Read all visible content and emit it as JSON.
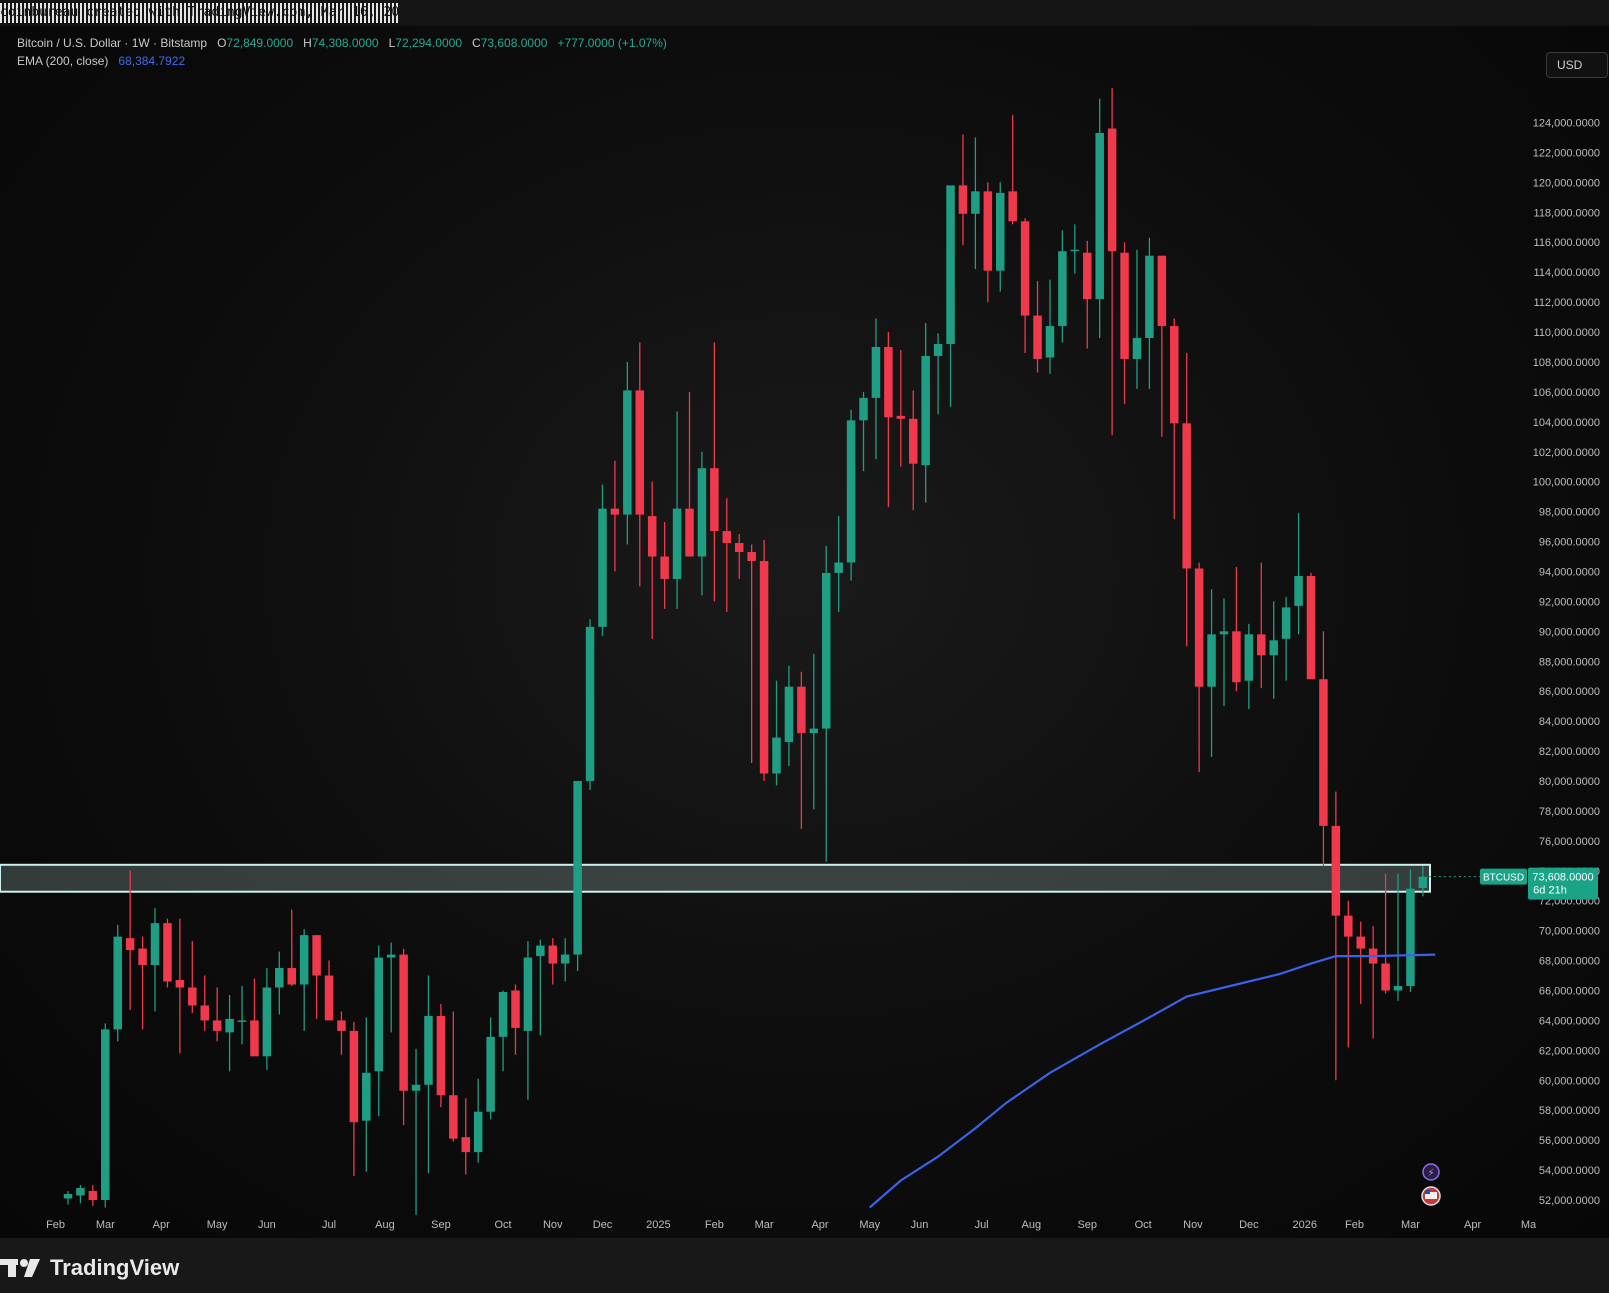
{
  "credit": "coinbureau created with TradingView.com, Mar 16, 2026 07:48 UTC+4",
  "legend": {
    "symbol": "Bitcoin / U.S. Dollar · 1W · Bitstamp",
    "o_label": "O",
    "o_value": "72,849.0000",
    "h_label": "H",
    "h_value": "74,308.0000",
    "l_label": "L",
    "l_value": "72,294.0000",
    "c_label": "C",
    "c_value": "73,608.0000",
    "change": "+777.0000 (+1.07%)",
    "ema_label": "EMA (200, close)",
    "ema_value": "68,384.7922"
  },
  "currency": "USD",
  "price_tag": {
    "symbol": "BTCUSD",
    "price": "73,608.0000",
    "countdown": "6d 21h"
  },
  "brand": "TradingView",
  "colors": {
    "up": "#1f9e84",
    "down": "#f0394c",
    "ema": "#3a62e8",
    "zone": "#c9f2f0",
    "tag": "#1aa386"
  },
  "chart_data": {
    "type": "candlestick",
    "interval": "1W",
    "ylim": [
      51000,
      128000
    ],
    "y_ticks": [
      "52,000.0000",
      "54,000.0000",
      "56,000.0000",
      "58,000.0000",
      "60,000.0000",
      "62,000.0000",
      "64,000.0000",
      "66,000.0000",
      "68,000.0000",
      "70,000.0000",
      "72,000.0000",
      "74,000.0000",
      "76,000.0000",
      "78,000.0000",
      "80,000.0000",
      "82,000.0000",
      "84,000.0000",
      "86,000.0000",
      "88,000.0000",
      "90,000.0000",
      "92,000.0000",
      "94,000.0000",
      "96,000.0000",
      "98,000.0000",
      "100,000.0000",
      "102,000.0000",
      "104,000.0000",
      "106,000.0000",
      "108,000.0000",
      "110,000.0000",
      "112,000.0000",
      "114,000.0000",
      "116,000.0000",
      "118,000.0000",
      "120,000.0000",
      "122,000.0000",
      "124,000.0000"
    ],
    "x_ticks": [
      {
        "label": "Feb",
        "index": -1
      },
      {
        "label": "Mar",
        "index": 3
      },
      {
        "label": "Apr",
        "index": 7.5
      },
      {
        "label": "May",
        "index": 12
      },
      {
        "label": "Jun",
        "index": 16
      },
      {
        "label": "Jul",
        "index": 21
      },
      {
        "label": "Aug",
        "index": 25.5
      },
      {
        "label": "Sep",
        "index": 30
      },
      {
        "label": "Oct",
        "index": 35
      },
      {
        "label": "Nov",
        "index": 39
      },
      {
        "label": "Dec",
        "index": 43
      },
      {
        "label": "2025",
        "index": 47.5
      },
      {
        "label": "Feb",
        "index": 52
      },
      {
        "label": "Mar",
        "index": 56
      },
      {
        "label": "Apr",
        "index": 60.5
      },
      {
        "label": "May",
        "index": 64.5
      },
      {
        "label": "Jun",
        "index": 68.5
      },
      {
        "label": "Jul",
        "index": 73.5
      },
      {
        "label": "Aug",
        "index": 77.5
      },
      {
        "label": "Sep",
        "index": 82
      },
      {
        "label": "Oct",
        "index": 86.5
      },
      {
        "label": "Nov",
        "index": 90.5
      },
      {
        "label": "Dec",
        "index": 95
      },
      {
        "label": "2026",
        "index": 99.5
      },
      {
        "label": "Feb",
        "index": 103.5
      },
      {
        "label": "Mar",
        "index": 108
      },
      {
        "label": "Apr",
        "index": 113
      },
      {
        "label": "Ma",
        "index": 117.5
      }
    ],
    "candles": [
      [
        52100,
        52600,
        51700,
        52400
      ],
      [
        52300,
        53000,
        51800,
        52800
      ],
      [
        52600,
        53000,
        51600,
        52000
      ],
      [
        52000,
        63800,
        51500,
        63400
      ],
      [
        63400,
        70400,
        62600,
        69600
      ],
      [
        69500,
        74000,
        64700,
        68700
      ],
      [
        68800,
        69600,
        63400,
        67700
      ],
      [
        67700,
        71500,
        64600,
        70500
      ],
      [
        70500,
        70800,
        66200,
        66600
      ],
      [
        66700,
        70800,
        61800,
        66200
      ],
      [
        66200,
        69300,
        64500,
        65000
      ],
      [
        65000,
        67000,
        63300,
        64000
      ],
      [
        64000,
        66200,
        62600,
        63300
      ],
      [
        63200,
        65700,
        60600,
        64100
      ],
      [
        64000,
        66300,
        62400,
        64000
      ],
      [
        64000,
        66800,
        62400,
        61600
      ],
      [
        61600,
        67500,
        60700,
        66200
      ],
      [
        66200,
        68600,
        64400,
        67500
      ],
      [
        67500,
        71400,
        66300,
        66400
      ],
      [
        66400,
        70100,
        63300,
        69700
      ],
      [
        69700,
        69600,
        64100,
        67000
      ],
      [
        67000,
        68000,
        64000,
        64000
      ],
      [
        64000,
        64600,
        61700,
        63300
      ],
      [
        63300,
        63900,
        53600,
        57200
      ],
      [
        57300,
        64200,
        53900,
        60500
      ],
      [
        60600,
        69000,
        57600,
        68200
      ],
      [
        68200,
        69200,
        63200,
        68400
      ],
      [
        68400,
        68800,
        57000,
        59300
      ],
      [
        59300,
        62100,
        51000,
        59700
      ],
      [
        59700,
        67000,
        53800,
        64300
      ],
      [
        64300,
        65100,
        58200,
        59000
      ],
      [
        59000,
        64600,
        55900,
        56100
      ],
      [
        56200,
        58800,
        53700,
        55200
      ],
      [
        55200,
        60100,
        54500,
        57900
      ],
      [
        57900,
        64200,
        57400,
        62900
      ],
      [
        62900,
        66000,
        60600,
        65900
      ],
      [
        66000,
        66400,
        61700,
        63500
      ],
      [
        63300,
        69300,
        58700,
        68200
      ],
      [
        68300,
        69400,
        63000,
        69000
      ],
      [
        69000,
        69500,
        66400,
        67800
      ],
      [
        67800,
        69500,
        66600,
        68400
      ],
      [
        68400,
        80000,
        67300,
        80000
      ],
      [
        80000,
        90800,
        79400,
        90300
      ],
      [
        90300,
        99800,
        89700,
        98200
      ],
      [
        98200,
        101400,
        94000,
        97800
      ],
      [
        97800,
        108000,
        95800,
        106100
      ],
      [
        106100,
        109300,
        93000,
        97800
      ],
      [
        97700,
        100000,
        89500,
        95000
      ],
      [
        95000,
        97300,
        91500,
        93500
      ],
      [
        93500,
        104700,
        91500,
        98200
      ],
      [
        98200,
        106000,
        96000,
        95000
      ],
      [
        95000,
        102000,
        92400,
        100900
      ],
      [
        100900,
        109300,
        92000,
        96700
      ],
      [
        96700,
        98900,
        91300,
        95900
      ],
      [
        95900,
        96500,
        93500,
        95300
      ],
      [
        95300,
        95800,
        81200,
        94700
      ],
      [
        94700,
        96100,
        80000,
        80500
      ],
      [
        80500,
        86700,
        79700,
        82900
      ],
      [
        82600,
        87700,
        81000,
        86300
      ],
      [
        86300,
        87300,
        76800,
        83200
      ],
      [
        83200,
        88500,
        78100,
        83500
      ],
      [
        83500,
        95700,
        74600,
        93900
      ],
      [
        93900,
        97700,
        91300,
        94600
      ],
      [
        94600,
        104800,
        93400,
        104100
      ],
      [
        104100,
        106000,
        100700,
        105600
      ],
      [
        105600,
        110900,
        101500,
        109000
      ],
      [
        109000,
        110000,
        98300,
        104300
      ],
      [
        104400,
        108800,
        101000,
        104200
      ],
      [
        104200,
        106100,
        98100,
        101200
      ],
      [
        101100,
        110600,
        98600,
        108400
      ],
      [
        108400,
        109900,
        104500,
        109200
      ],
      [
        109200,
        113500,
        105000,
        119800
      ],
      [
        119800,
        123200,
        115800,
        117900
      ],
      [
        117900,
        123000,
        114200,
        119400
      ],
      [
        119400,
        120000,
        112000,
        114100
      ],
      [
        114100,
        120000,
        112700,
        119300
      ],
      [
        119400,
        124500,
        117200,
        117400
      ],
      [
        117400,
        117600,
        108600,
        111100
      ],
      [
        111100,
        113400,
        107300,
        108200
      ],
      [
        108300,
        113500,
        107200,
        110400
      ],
      [
        110400,
        116800,
        109300,
        115400
      ],
      [
        115400,
        117200,
        113900,
        115500
      ],
      [
        115300,
        116100,
        108900,
        112200
      ],
      [
        112200,
        125600,
        109600,
        123300
      ],
      [
        123600,
        126300,
        103100,
        115400
      ],
      [
        115300,
        116000,
        105200,
        108200
      ],
      [
        108200,
        115500,
        106200,
        109600
      ],
      [
        109600,
        116300,
        106200,
        115100
      ],
      [
        115100,
        111200,
        103000,
        110400
      ],
      [
        110400,
        110900,
        97500,
        103900
      ],
      [
        103900,
        108600,
        89000,
        94200
      ],
      [
        94200,
        94600,
        80600,
        86300
      ],
      [
        86300,
        92800,
        81600,
        89800
      ],
      [
        89800,
        92200,
        85000,
        90000
      ],
      [
        90000,
        94300,
        86000,
        86600
      ],
      [
        86700,
        90500,
        84800,
        89800
      ],
      [
        89800,
        94600,
        86200,
        88400
      ],
      [
        88400,
        92000,
        85500,
        89400
      ],
      [
        89500,
        92300,
        86700,
        91600
      ],
      [
        91700,
        97900,
        89800,
        93700
      ],
      [
        93700,
        93900,
        88900,
        86800
      ],
      [
        86800,
        90000,
        74300,
        77000
      ],
      [
        77000,
        79300,
        60000,
        71000
      ],
      [
        71000,
        72000,
        62200,
        69600
      ],
      [
        69600,
        70600,
        65100,
        68800
      ],
      [
        68800,
        70300,
        62800,
        67800
      ],
      [
        67800,
        73800,
        65800,
        66000
      ],
      [
        66000,
        73800,
        65300,
        66300
      ],
      [
        66300,
        74100,
        65900,
        72800
      ],
      [
        72849,
        74308,
        72294,
        73608
      ]
    ],
    "ema_200": [
      [
        64.5,
        51500
      ],
      [
        67,
        53300
      ],
      [
        70,
        54900
      ],
      [
        73,
        56800
      ],
      [
        75.5,
        58500
      ],
      [
        79,
        60500
      ],
      [
        83,
        62400
      ],
      [
        87,
        64200
      ],
      [
        90,
        65600
      ],
      [
        94,
        66400
      ],
      [
        97.5,
        67100
      ],
      [
        100,
        67800
      ],
      [
        102,
        68300
      ],
      [
        105,
        68300
      ],
      [
        110,
        68400
      ]
    ],
    "zone": {
      "low": 72600,
      "high": 74400
    },
    "last_price": 73608
  }
}
